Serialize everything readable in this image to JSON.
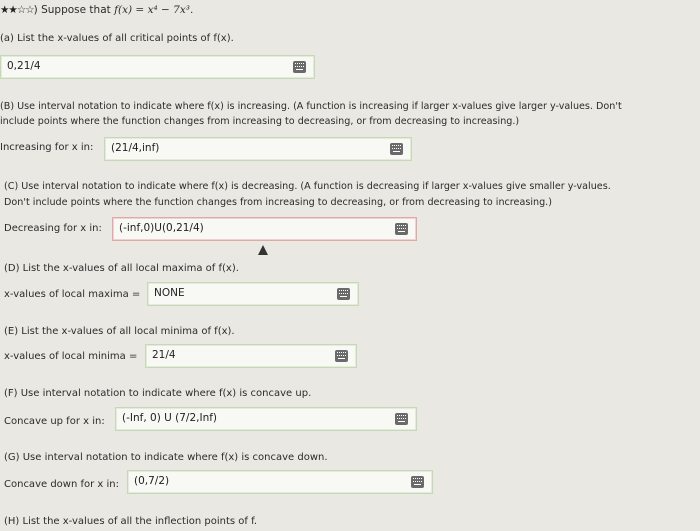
{
  "header": {
    "stars": "★★☆☆",
    "text_prefix": ") Suppose that ",
    "function_expr": "f(x) = x⁴ − 7x³."
  },
  "a": {
    "prompt": "(a) List the x-values of all critical points of f(x).",
    "value": "0,21/4"
  },
  "b": {
    "line1": "(B) Use interval notation to indicate where f(x) is increasing. (A function is increasing if larger x-values give larger y-values. Don't",
    "line2": "include points where the function changes from increasing to decreasing, or from decreasing to increasing.)",
    "label": "Increasing for x in:",
    "value": "(21/4,inf)"
  },
  "c": {
    "line1": "(C) Use interval notation to indicate where f(x) is decreasing. (A function is decreasing if larger x-values give smaller y-values.",
    "line2": "Don't include points where the function changes from increasing to decreasing, or from decreasing to increasing.)",
    "label": "Decreasing for x in:",
    "value": "(-inf,0)U(0,21/4)"
  },
  "d": {
    "prompt": "(D) List the x-values of all local maxima of f(x).",
    "label": "x-values of local maxima =",
    "value": "NONE"
  },
  "e": {
    "prompt": "(E) List the x-values of all local minima of f(x).",
    "label": "x-values of local minima =",
    "value": "21/4"
  },
  "f": {
    "prompt": "(F) Use interval notation to indicate where f(x) is concave up.",
    "label": "Concave up for x in:",
    "value": "(-Inf, 0) U (7/2,Inf)"
  },
  "g": {
    "prompt": "(G) Use interval notation to indicate where f(x) is concave down.",
    "label": "Concave down for x in:",
    "value": "(0,7/2)"
  },
  "h": {
    "prompt": "(H) List the x-values of all the inflection points of f."
  },
  "icons": {
    "keyboard": "keyboard-icon",
    "cursor": "mouse-cursor-icon"
  },
  "colors": {
    "background": "#e9e8e3",
    "field_border": "#c7d7b9",
    "field_border_error": "#e2a8a8"
  }
}
